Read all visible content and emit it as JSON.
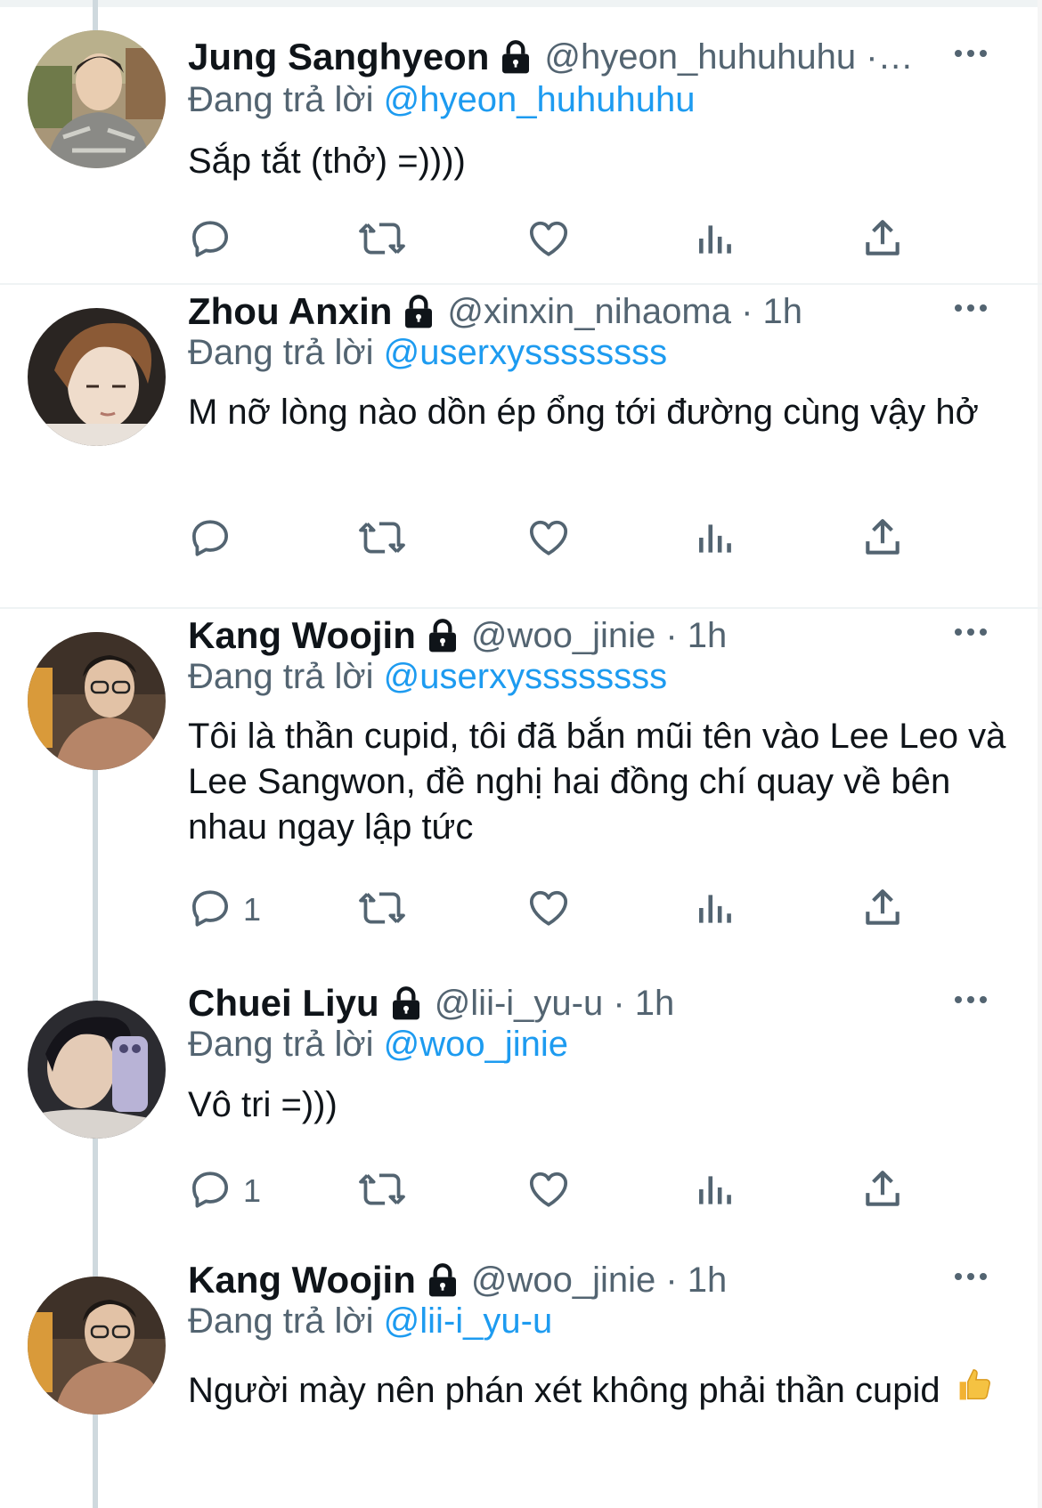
{
  "tweets": [
    {
      "display_name": "Jung Sanghyeon",
      "handle": "@hyeon_huhuhuhu ·…",
      "replying_prefix": "Đang trả lời",
      "replying_to": "@hyeon_huhuhuhu",
      "text": "Sắp tắt (thở) =))))",
      "reply_count": ""
    },
    {
      "display_name": "Zhou Anxin",
      "handle": "@xinxin_nihaoma · 1h",
      "replying_prefix": "Đang trả lời",
      "replying_to": "@userxyssssssss",
      "text": "M nỡ lòng nào dồn ép ổng tới đường cùng vậy hở",
      "reply_count": ""
    },
    {
      "display_name": "Kang Woojin",
      "handle": "@woo_jinie · 1h",
      "replying_prefix": "Đang trả lời",
      "replying_to": "@userxyssssssss",
      "text": "Tôi là thần cupid, tôi đã bắn mũi tên vào Lee Leo và Lee Sangwon, đề nghị hai đồng chí quay về bên nhau ngay lập tức",
      "reply_count": "1"
    },
    {
      "display_name": "Chuei Liyu",
      "handle": "@lii-i_yu-u · 1h",
      "replying_prefix": "Đang trả lời",
      "replying_to": "@woo_jinie",
      "text": "Vô tri =)))",
      "reply_count": "1"
    },
    {
      "display_name": "Kang Woojin",
      "handle": "@woo_jinie · 1h",
      "replying_prefix": "Đang trả lời",
      "replying_to": "@lii-i_yu-u",
      "text": "Người mày nên phán xét không phải thần cupid",
      "reply_count": "",
      "emoji": "thumbs-up"
    }
  ],
  "colors": {
    "text": "#0f1419",
    "secondary": "#536471",
    "mention": "#1d9bf0",
    "divider": "#eff3f4",
    "thread_line": "#cfd9de"
  },
  "icons": [
    "lock-icon",
    "reply-icon",
    "retweet-icon",
    "like-icon",
    "analytics-icon",
    "share-icon",
    "more-icon"
  ]
}
